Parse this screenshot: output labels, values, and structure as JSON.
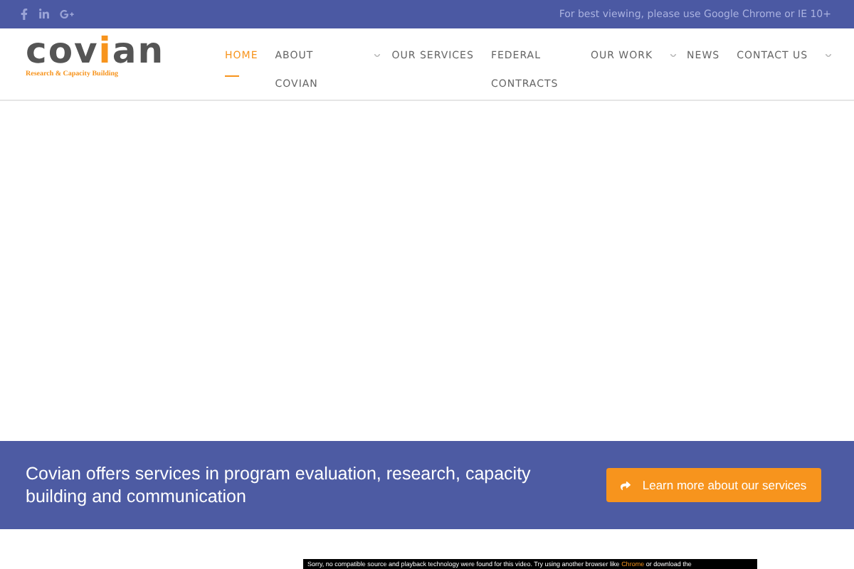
{
  "top_bar": {
    "notice": "For best viewing, please use Google Chrome or IE 10+"
  },
  "logo": {
    "name_before": "cov",
    "name_highlight": "i",
    "name_after": "an",
    "tagline": "Research & Capacity Building"
  },
  "nav": [
    {
      "label": "HOME",
      "selected": true,
      "has_submenu": false
    },
    {
      "label": "ABOUT COVIAN",
      "selected": false,
      "has_submenu": true
    },
    {
      "label": "OUR SERVICES",
      "selected": false,
      "has_submenu": false
    },
    {
      "label": "FEDERAL CONTRACTS",
      "selected": false,
      "has_submenu": false
    },
    {
      "label": "OUR WORK",
      "selected": false,
      "has_submenu": true
    },
    {
      "label": "NEWS",
      "selected": false,
      "has_submenu": false
    },
    {
      "label": "CONTACT US",
      "selected": false,
      "has_submenu": true
    }
  ],
  "banner": {
    "text": "Covian offers services in program evaluation, research, capacity building and communication",
    "button": "Learn more about our services"
  },
  "video_error": {
    "text_before": "Sorry, no compatible source and playback technology were found for this video. Try using another browser like",
    "link": "Chrome",
    "text_after": "or download the"
  }
}
